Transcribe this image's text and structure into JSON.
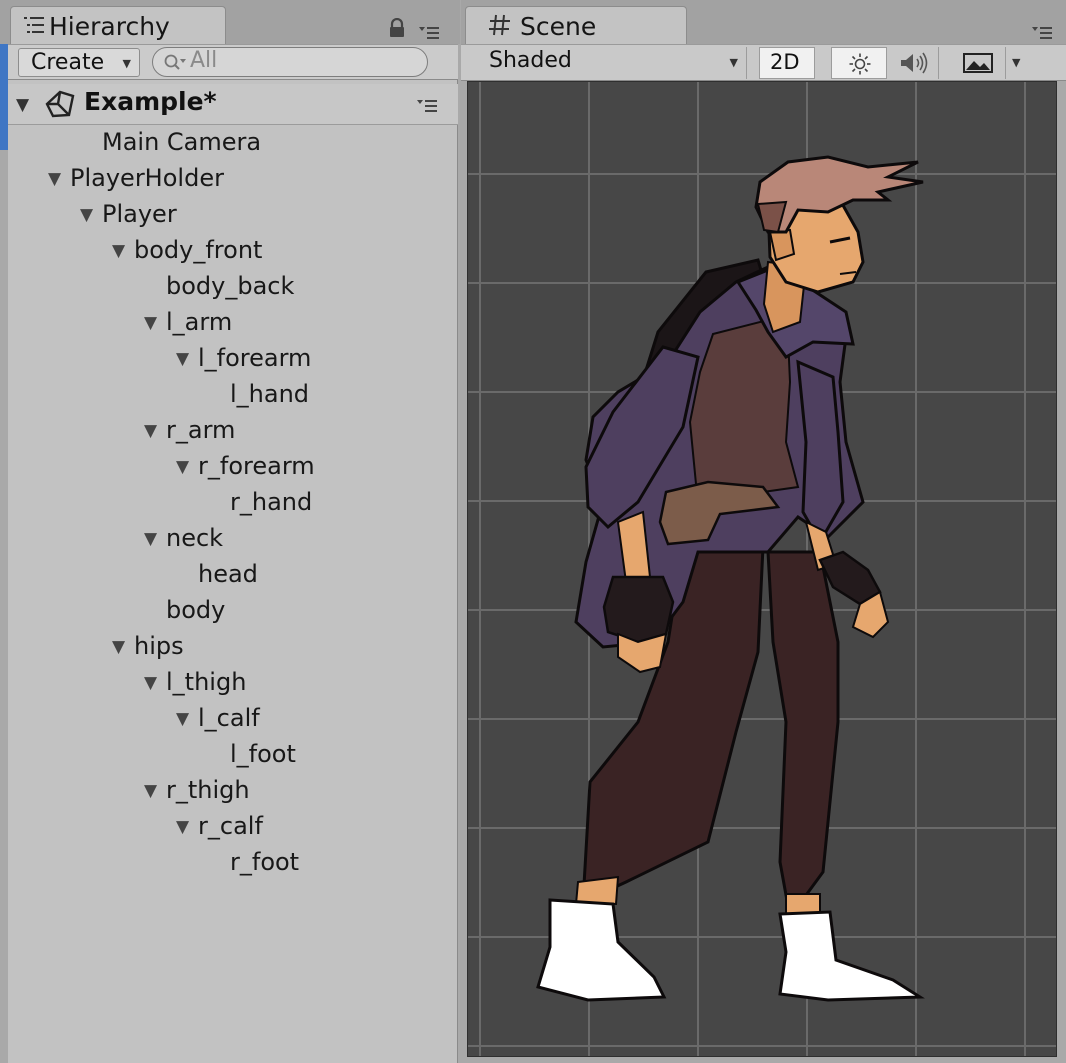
{
  "hierarchy": {
    "tab_label": "Hierarchy",
    "create_label": "Create",
    "search_placeholder": "All",
    "scene_name": "Example*",
    "rows": [
      {
        "label": "Main Camera",
        "depth": 1,
        "expanded": null
      },
      {
        "label": "PlayerHolder",
        "depth": 0,
        "expanded": true
      },
      {
        "label": "Player",
        "depth": 1,
        "expanded": true
      },
      {
        "label": "body_front",
        "depth": 2,
        "expanded": true
      },
      {
        "label": "body_back",
        "depth": 3,
        "expanded": null
      },
      {
        "label": "l_arm",
        "depth": 3,
        "expanded": true
      },
      {
        "label": "l_forearm",
        "depth": 4,
        "expanded": true
      },
      {
        "label": "l_hand",
        "depth": 5,
        "expanded": null
      },
      {
        "label": "r_arm",
        "depth": 3,
        "expanded": true
      },
      {
        "label": "r_forearm",
        "depth": 4,
        "expanded": true
      },
      {
        "label": "r_hand",
        "depth": 5,
        "expanded": null
      },
      {
        "label": "neck",
        "depth": 3,
        "expanded": true
      },
      {
        "label": "head",
        "depth": 4,
        "expanded": null
      },
      {
        "label": "body",
        "depth": 3,
        "expanded": null
      },
      {
        "label": "hips",
        "depth": 2,
        "expanded": true
      },
      {
        "label": "l_thigh",
        "depth": 3,
        "expanded": true
      },
      {
        "label": "l_calf",
        "depth": 4,
        "expanded": true
      },
      {
        "label": "l_foot",
        "depth": 5,
        "expanded": null
      },
      {
        "label": "r_thigh",
        "depth": 3,
        "expanded": true
      },
      {
        "label": "r_calf",
        "depth": 4,
        "expanded": true
      },
      {
        "label": "r_foot",
        "depth": 5,
        "expanded": null
      }
    ]
  },
  "scene": {
    "tab_label": "Scene",
    "shading_mode": "Shaded",
    "mode_2d_label": "2D",
    "icons": [
      "hash-icon",
      "sun-icon",
      "speaker-icon",
      "image-icon",
      "lock-icon",
      "panel-menu-icon",
      "unity-logo-icon",
      "search-icon"
    ]
  },
  "colors": {
    "viewport_bg": "#474747",
    "grid_line": "#6a6a6a",
    "panel_bg": "#c2c2c2",
    "toolbar_bg": "#c9c9c9",
    "coat": "#4e3f5f",
    "pants": "#3a2324",
    "skin": "#e6a76e",
    "hair": "#b98778",
    "shoes": "#ffffff"
  }
}
